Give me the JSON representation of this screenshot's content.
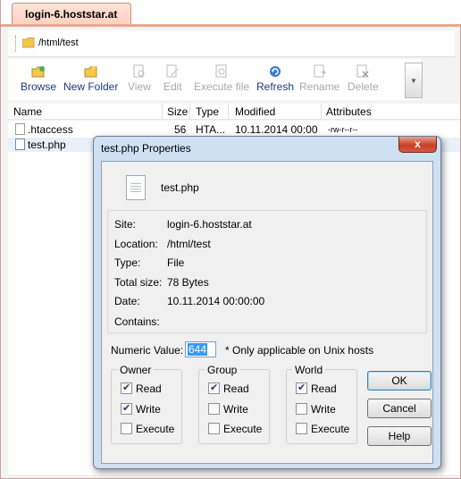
{
  "tab": {
    "label": "login-6.hoststar.at"
  },
  "path": {
    "value": "/html/test"
  },
  "toolbar": {
    "buttons": [
      {
        "label": "Browse",
        "icon": "browse-icon",
        "enabled": true
      },
      {
        "label": "New Folder",
        "icon": "new-folder-icon",
        "enabled": true
      },
      {
        "label": "View",
        "icon": "view-icon",
        "enabled": false
      },
      {
        "label": "Edit",
        "icon": "edit-icon",
        "enabled": false
      },
      {
        "label": "Execute file",
        "icon": "execute-icon",
        "enabled": false
      },
      {
        "label": "Refresh",
        "icon": "refresh-icon",
        "enabled": true
      },
      {
        "label": "Rename",
        "icon": "rename-icon",
        "enabled": false
      },
      {
        "label": "Delete",
        "icon": "delete-icon",
        "enabled": false
      }
    ]
  },
  "filelist": {
    "columns": [
      "Name",
      "Size",
      "Type",
      "Modified",
      "Attributes"
    ],
    "rows": [
      {
        "name": ".htaccess",
        "size": "56",
        "type": "HTA...",
        "modified": "10.11.2014 00:00",
        "attributes": "-rw-r--r--"
      },
      {
        "name": "test.php",
        "size": "",
        "type": "",
        "modified": "",
        "attributes": ""
      }
    ]
  },
  "dialog": {
    "title": "test.php Properties",
    "close_label": "x",
    "filename": "test.php",
    "info": {
      "site_label": "Site:",
      "site": "login-6.hoststar.at",
      "location_label": "Location:",
      "location": "/html/test",
      "type_label": "Type:",
      "type": "File",
      "size_label": "Total size:",
      "size": "78 Bytes",
      "date_label": "Date:",
      "date": "10.11.2014 00:00:00",
      "contains_label": "Contains:",
      "contains": ""
    },
    "numeric_label": "Numeric Value:",
    "numeric_value": "644",
    "numeric_note": "* Only applicable on Unix hosts",
    "groups": {
      "owner": {
        "label": "Owner",
        "read": "Read",
        "write": "Write",
        "execute": "Execute"
      },
      "group": {
        "label": "Group",
        "read": "Read",
        "write": "Write",
        "execute": "Execute"
      },
      "world": {
        "label": "World",
        "read": "Read",
        "write": "Write",
        "execute": "Execute"
      }
    },
    "buttons": {
      "ok": "OK",
      "cancel": "Cancel",
      "help": "Help"
    }
  },
  "colors": {
    "accent": "#e7a98f",
    "dialog_frame": "#cfe0f2",
    "close": "#c8402a"
  }
}
